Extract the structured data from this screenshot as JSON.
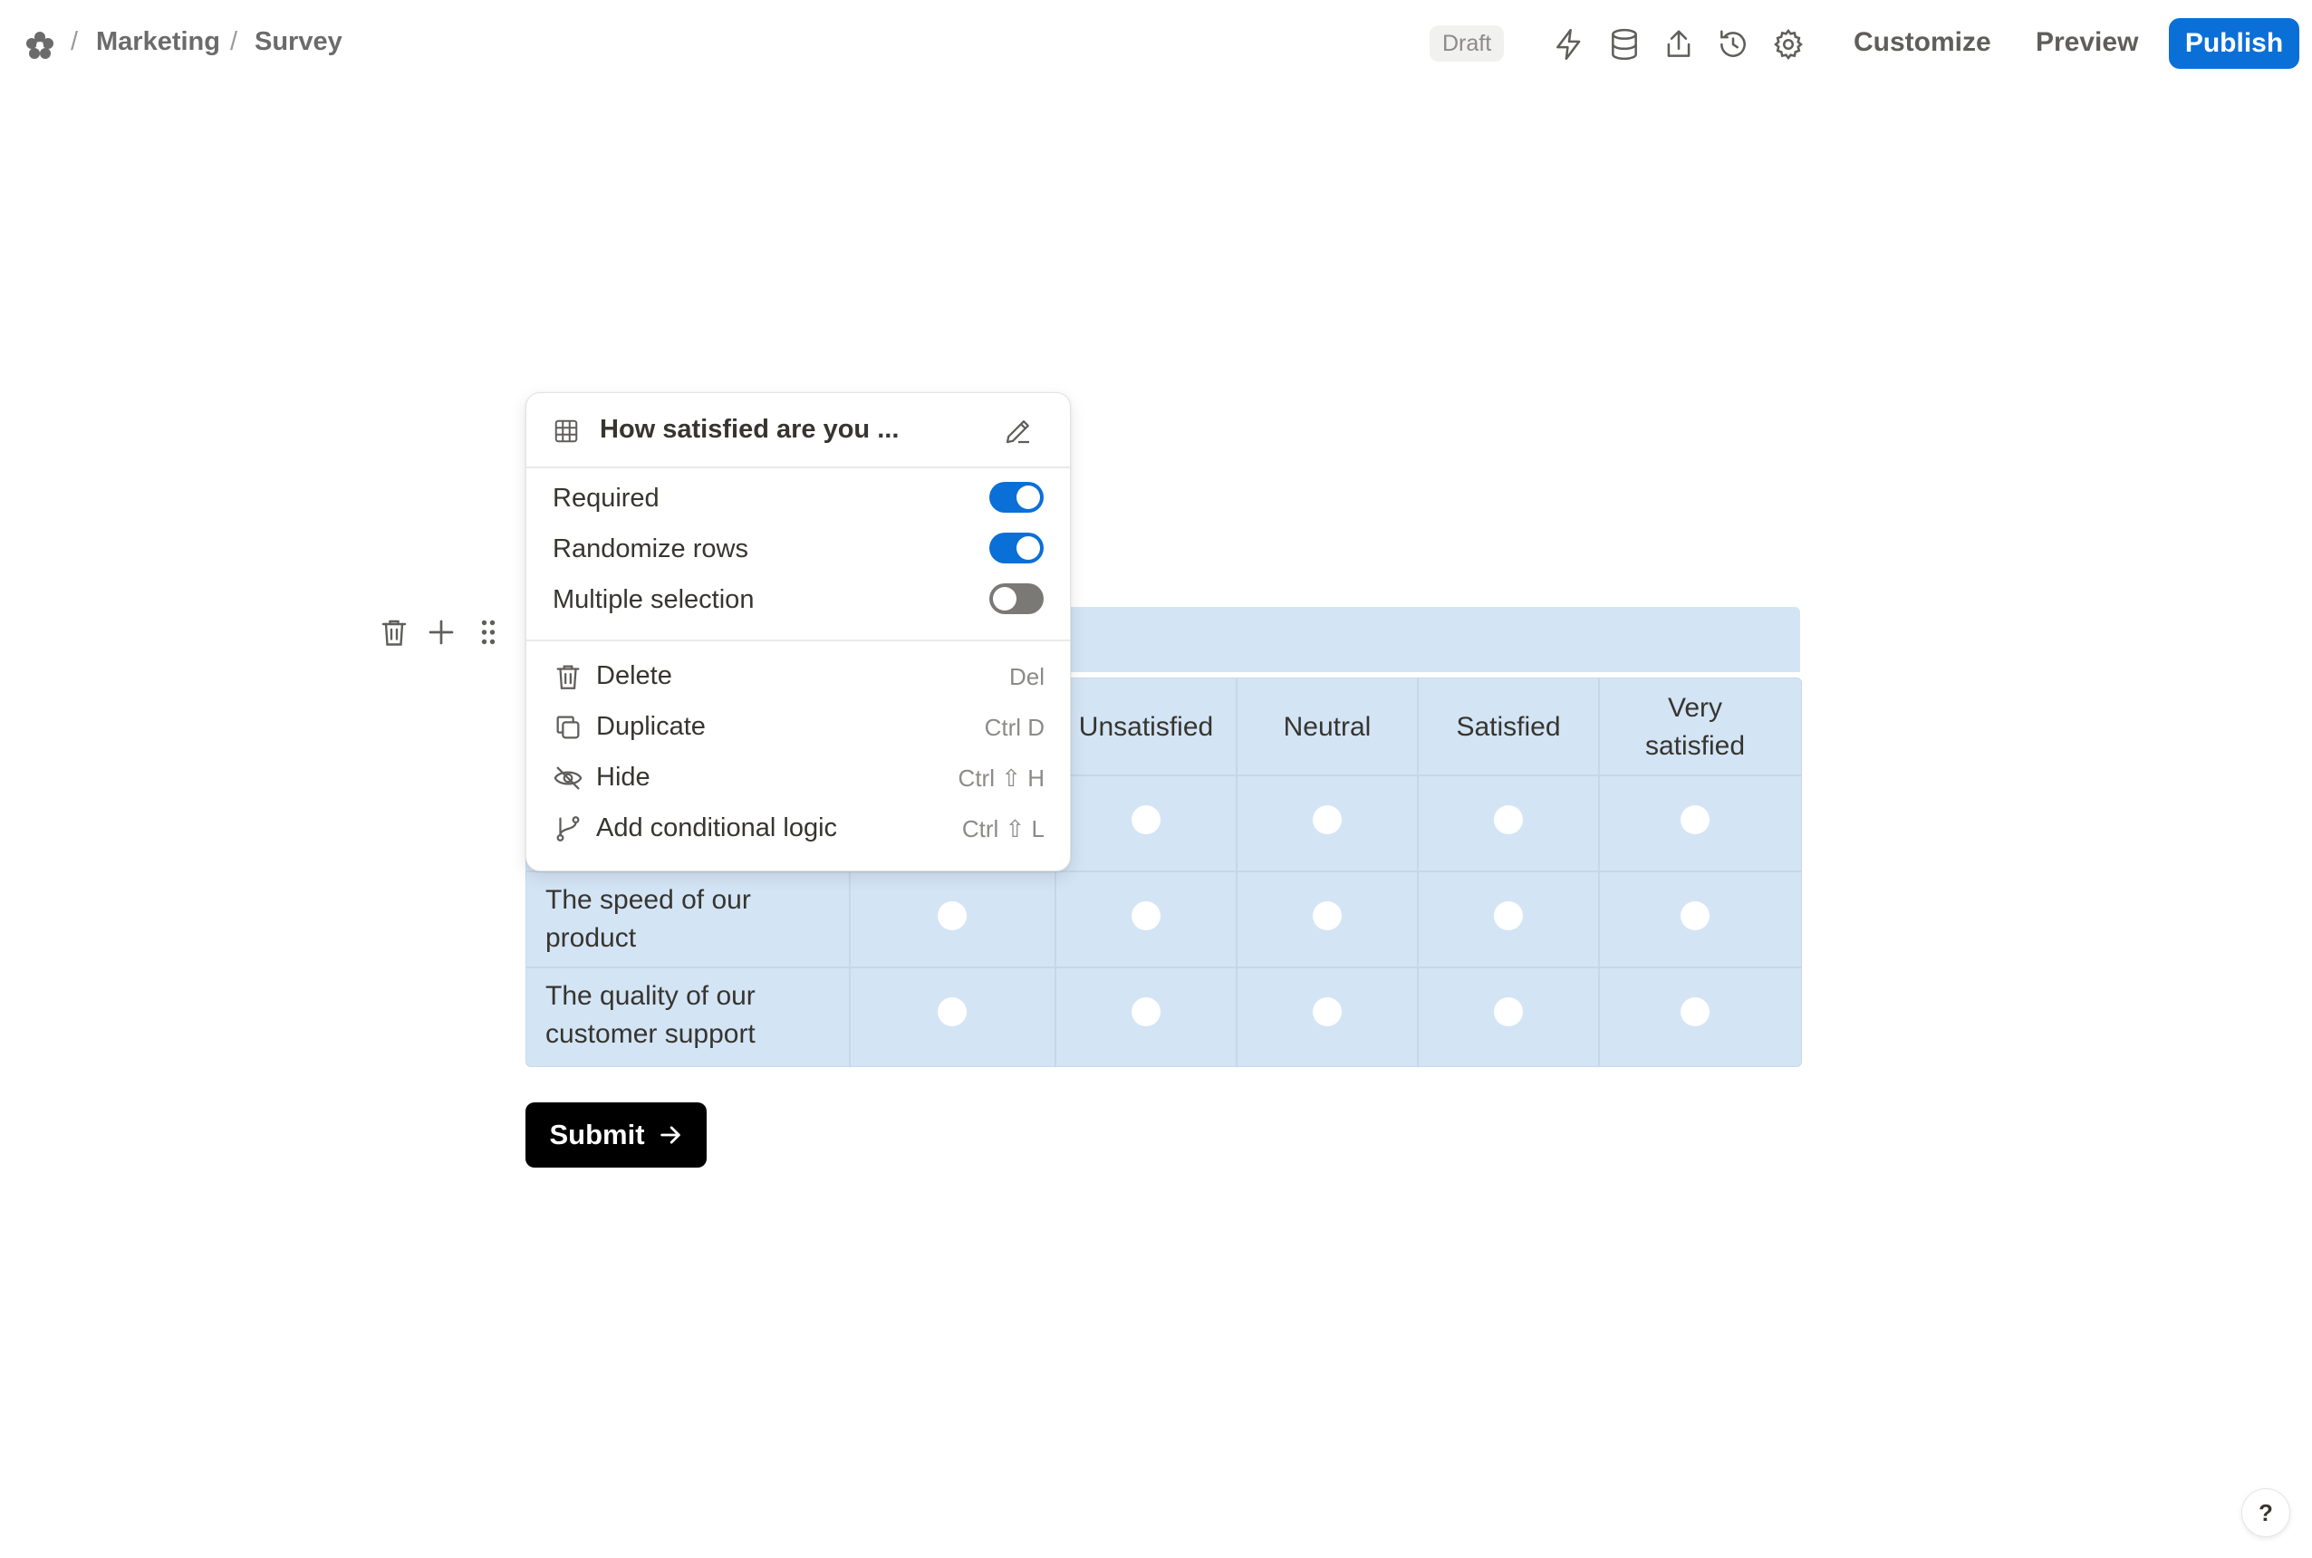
{
  "header": {
    "breadcrumb": [
      "Marketing",
      "Survey"
    ],
    "separator": "/",
    "status_badge": "Draft",
    "icons": [
      "lightning-icon",
      "database-icon",
      "share-icon",
      "history-icon",
      "settings-icon"
    ],
    "customize_label": "Customize",
    "preview_label": "Preview",
    "publish_label": "Publish"
  },
  "popover": {
    "title": "How satisfied are you ...",
    "toggles": [
      {
        "label": "Required",
        "on": true
      },
      {
        "label": "Randomize rows",
        "on": true
      },
      {
        "label": "Multiple selection",
        "on": false
      }
    ],
    "menu": [
      {
        "label": "Delete",
        "shortcut": "Del",
        "icon": "trash-icon"
      },
      {
        "label": "Duplicate",
        "shortcut": "Ctrl D",
        "icon": "copy-icon"
      },
      {
        "label": "Hide",
        "shortcut": "Ctrl ⇧ H",
        "icon": "eye-off-icon"
      },
      {
        "label": "Add conditional logic",
        "shortcut": "Ctrl ⇧ L",
        "icon": "branch-icon"
      }
    ]
  },
  "matrix": {
    "columns": [
      "Unsatisfied",
      "Neutral",
      "Satisfied",
      "Very satisfied"
    ],
    "rows": [
      "The speed of our product",
      "The quality of our customer support"
    ]
  },
  "submit_label": "Submit",
  "help_label": "?",
  "colors": {
    "accent": "#0b6fd8",
    "matrix_bg": "#d3e4f5",
    "toggle_off": "#7a7976"
  }
}
